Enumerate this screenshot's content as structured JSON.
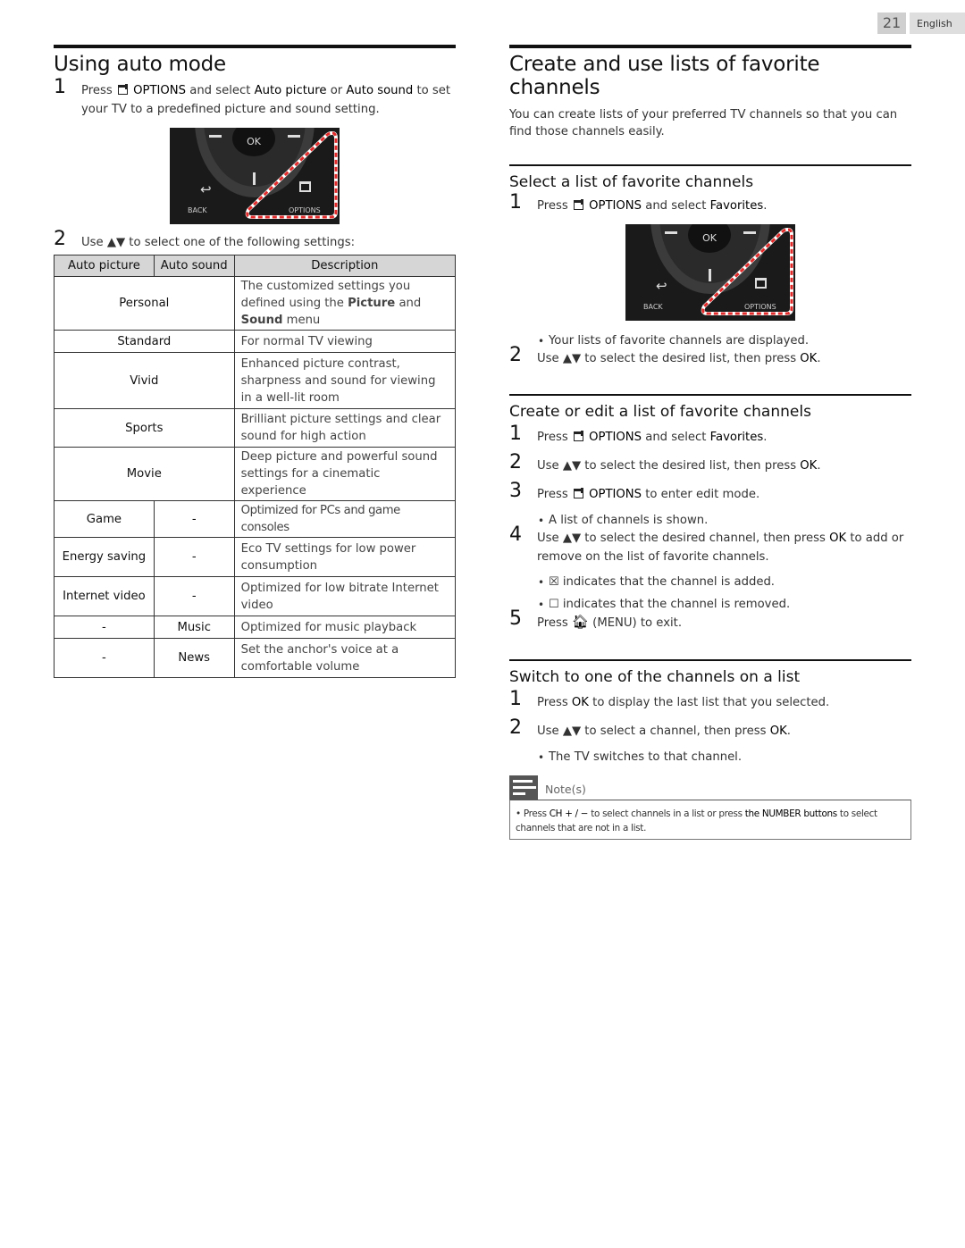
{
  "header": {
    "page_number": "21",
    "language": "English"
  },
  "left": {
    "title": "Using auto mode",
    "step1": {
      "num": "1",
      "pre": "Press",
      "options": "OPTIONS",
      "mid1": "and select",
      "auto_picture": "Auto picture",
      "or": "or",
      "auto_sound": "Auto sound",
      "post": "to set your TV to a predefined picture and sound setting."
    },
    "remote": {
      "ok": "OK",
      "back": "BACK",
      "options": "OPTIONS"
    },
    "step2": {
      "num": "2",
      "text": "Use ▲▼ to select one of the following settings:"
    },
    "table": {
      "headers": [
        "Auto picture",
        "Auto sound",
        "Description"
      ],
      "rows": [
        {
          "merged": "Personal",
          "desc_pre": "The customized settings you defined using the",
          "picture": "Picture",
          "and": "and",
          "sound": "Sound",
          "desc_post": "menu"
        },
        {
          "merged": "Standard",
          "desc": "For normal TV viewing"
        },
        {
          "merged": "Vivid",
          "desc": "Enhanced picture contrast, sharpness and sound for viewing in a well-lit room"
        },
        {
          "merged": "Sports",
          "desc": "Brilliant picture settings and clear sound for high action"
        },
        {
          "merged": "Movie",
          "desc": "Deep picture and powerful sound settings for a cinematic experience"
        },
        {
          "picture": "Game",
          "sound": "-",
          "desc": "Optimized for PCs and game consoles"
        },
        {
          "picture": "Energy saving",
          "sound": "-",
          "desc": "Eco TV settings for low power consumption"
        },
        {
          "picture": "Internet video",
          "sound": "-",
          "desc": "Optimized for low bitrate Internet video"
        },
        {
          "picture": "-",
          "sound": "Music",
          "desc": "Optimized for music playback"
        },
        {
          "picture": "-",
          "sound": "News",
          "desc": "Set the anchor's voice at a comfortable volume"
        }
      ]
    }
  },
  "right": {
    "title": "Create and use lists of favorite channels",
    "intro": "You can create lists of your preferred TV channels so that you can find those channels easily.",
    "select": {
      "title": "Select a list of favorite channels",
      "step1": {
        "num": "1",
        "pre": "Press",
        "options": "OPTIONS",
        "mid": "and select",
        "fav": "Favorites",
        "post": "."
      },
      "bullet1": "Your lists of favorite channels are displayed.",
      "step2": {
        "num": "2",
        "pre": "Use ▲▼ to select the desired list, then press",
        "ok": "OK",
        "post": "."
      }
    },
    "create": {
      "title": "Create or edit a list of favorite channels",
      "step1": {
        "num": "1",
        "pre": "Press",
        "options": "OPTIONS",
        "mid": "and select",
        "fav": "Favorites",
        "post": "."
      },
      "step2": {
        "num": "2",
        "pre": "Use ▲▼ to select the desired list, then press",
        "ok": "OK",
        "post": "."
      },
      "step3": {
        "num": "3",
        "pre": "Press",
        "options": "OPTIONS",
        "post": "to enter edit mode."
      },
      "bullet1": "A list of channels is shown.",
      "step4": {
        "num": "4",
        "pre": "Use ▲▼ to select the desired channel, then press",
        "ok": "OK",
        "post": "to add or remove on the list of favorite channels."
      },
      "bullet2": "indicates that the channel is added.",
      "bullet3": "indicates that the channel is removed.",
      "step5": {
        "num": "5",
        "pre": "Press",
        "menu": "(MENU) to exit."
      }
    },
    "switch": {
      "title": "Switch to one of the channels on a list",
      "step1": {
        "num": "1",
        "pre": "Press",
        "ok": "OK",
        "post": "to display the last list that you selected."
      },
      "step2": {
        "num": "2",
        "pre": "Use ▲▼ to select a channel, then press",
        "ok": "OK",
        "post": "."
      },
      "bullet1": "The TV switches to that channel."
    },
    "notes": {
      "label": "Note(s)",
      "pre": "Press",
      "ch": "CH + / −",
      "mid": "to select channels in a list or press",
      "number": "the NUMBER buttons",
      "post": "to select channels that are not in a list."
    }
  },
  "colors": {
    "dashed_highlight": "#e32b2b",
    "table_header_bg": "#d6d6d6",
    "badge_bg": "#cfcfcf"
  }
}
